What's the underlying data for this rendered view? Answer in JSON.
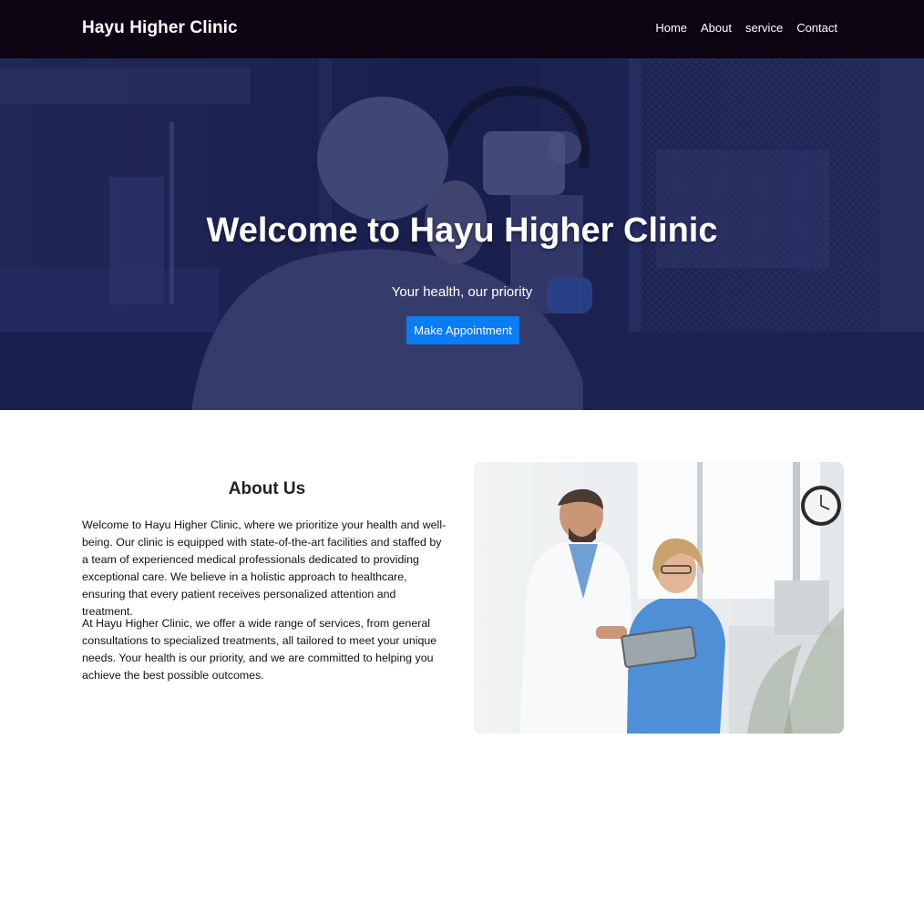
{
  "header": {
    "brand": "Hayu Higher Clinic",
    "nav": [
      "Home",
      "About",
      "service",
      "Contact"
    ]
  },
  "hero": {
    "title": "Welcome to Hayu Higher Clinic",
    "subtitle": "Your health, our priority",
    "cta_label": "Make Appointment"
  },
  "about": {
    "heading": "About Us",
    "paragraphs": [
      "Welcome to Hayu Higher Clinic, where we prioritize your health and well-being. Our clinic is equipped with state-of-the-art facilities and staffed by a team of experienced medical professionals dedicated to providing exceptional care. We believe in a holistic approach to healthcare, ensuring that every patient receives personalized attention and treatment.",
      "At Hayu Higher Clinic, we offer a wide range of services, from general consultations to specialized treatments, all tailored to meet your unique needs. Your health is our priority, and we are committed to helping you achieve the best possible outcomes."
    ]
  },
  "colors": {
    "header_bg": "#0d0414",
    "hero_overlay": "#1d2350",
    "cta_bg": "#0a7cf4",
    "nurse_scrubs": "#4f8fd6"
  }
}
